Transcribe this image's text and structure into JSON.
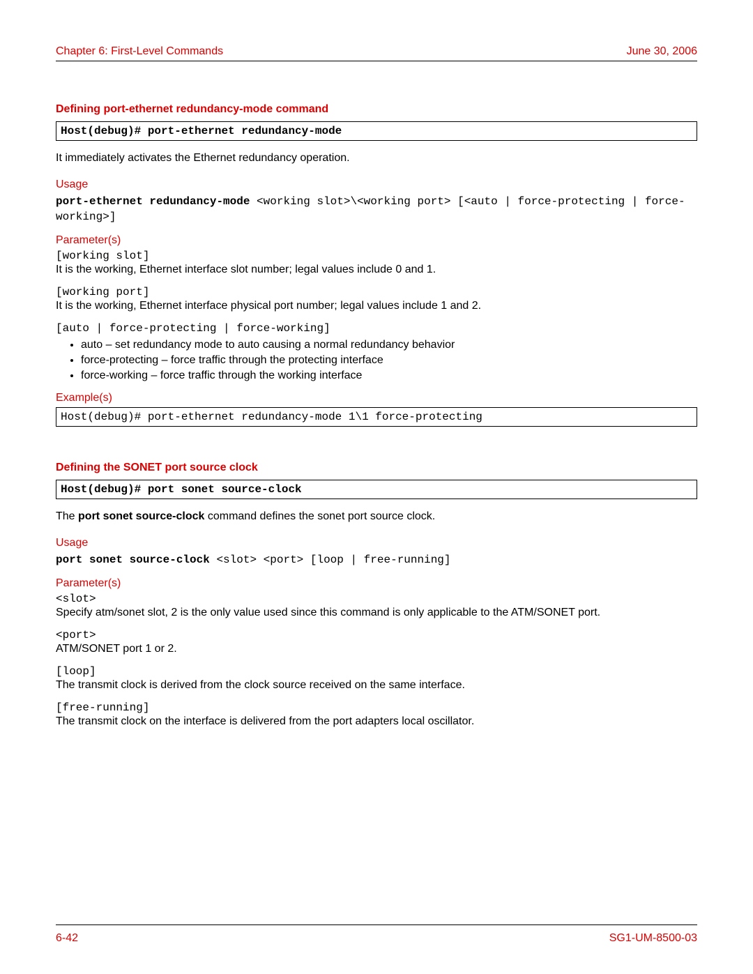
{
  "header": {
    "left": "Chapter 6: First-Level Commands",
    "right": "June 30, 2006"
  },
  "section1": {
    "title": "Defining port-ethernet redundancy-mode command",
    "cmd": "Host(debug)# port-ethernet redundancy-mode",
    "intro": "It immediately activates the Ethernet redundancy operation.",
    "usage_label": "Usage",
    "usage_bold": "port-ethernet redundancy-mode",
    "usage_rest": " <working slot>\\<working port> [<auto | force-protecting | force-working>]",
    "params_label": "Parameter(s)",
    "p1_name": "[working slot]",
    "p1_desc": "It is the working, Ethernet interface slot number; legal values include 0 and 1.",
    "p2_name": "[working port]",
    "p2_desc": "It is the working, Ethernet interface physical port number; legal values include 1 and 2.",
    "p3_name": "[auto | force-protecting | force-working]",
    "modes": [
      "auto – set redundancy mode to auto causing a normal redundancy behavior",
      "force-protecting – force traffic through the protecting interface",
      "force-working – force traffic through the working interface"
    ],
    "examples_label": "Example(s)",
    "example": "Host(debug)# port-ethernet redundancy-mode 1\\1 force-protecting"
  },
  "section2": {
    "title": "Defining the SONET port source clock",
    "cmd": "Host(debug)# port sonet source-clock",
    "intro_pre": "The ",
    "intro_bold": "port sonet source-clock",
    "intro_post": " command defines the sonet port source clock.",
    "usage_label": "Usage",
    "usage_bold": "port sonet source-clock",
    "usage_rest": " <slot> <port> [loop | free-running]",
    "params_label": "Parameter(s)",
    "p1_name": "<slot>",
    "p1_desc": "Specify atm/sonet slot, 2 is the only value used since this command is only applicable to the ATM/SONET port.",
    "p2_name": "<port>",
    "p2_desc": "ATM/SONET port 1 or 2.",
    "p3_name": "[loop]",
    "p3_desc": "The transmit clock is derived from the clock source received on the same interface.",
    "p4_name": "[free-running]",
    "p4_desc": "The transmit clock on the interface is delivered from the port adapters local oscillator."
  },
  "footer": {
    "left": "6-42",
    "right": "SG1-UM-8500-03"
  }
}
